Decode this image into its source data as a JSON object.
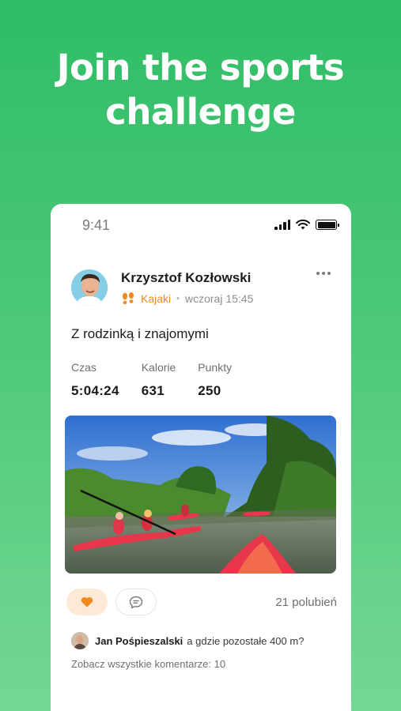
{
  "headline": {
    "line1": "Join the sports",
    "line2": "challenge"
  },
  "status_bar": {
    "time": "9:41",
    "icons": [
      "signal-icon",
      "wifi-icon",
      "battery-icon"
    ]
  },
  "post": {
    "author": "Krzysztof Kozłowski",
    "activity_icon": "footprints-icon",
    "activity": "Kajaki",
    "separator": "•",
    "timestamp": "wczoraj 15:45",
    "title": "Z rodzinką i znajomymi",
    "stats": [
      {
        "label": "Czas",
        "value": "5:04:24"
      },
      {
        "label": "Kalorie",
        "value": "631"
      },
      {
        "label": "Punkty",
        "value": "250"
      }
    ],
    "photo_icon": "kayaking-photo",
    "likes_label": "21 polubień",
    "comment": {
      "author": "Jan Pośpieszalski",
      "text": "a gdzie pozostałe 400 m?"
    },
    "all_comments_label": "Zobacz wszystkie komentarze: 10"
  },
  "colors": {
    "background_top": "#2fbd66",
    "background_bottom": "#74d795",
    "accent_orange": "#f08a1c",
    "like_bg": "#fde9d5"
  }
}
